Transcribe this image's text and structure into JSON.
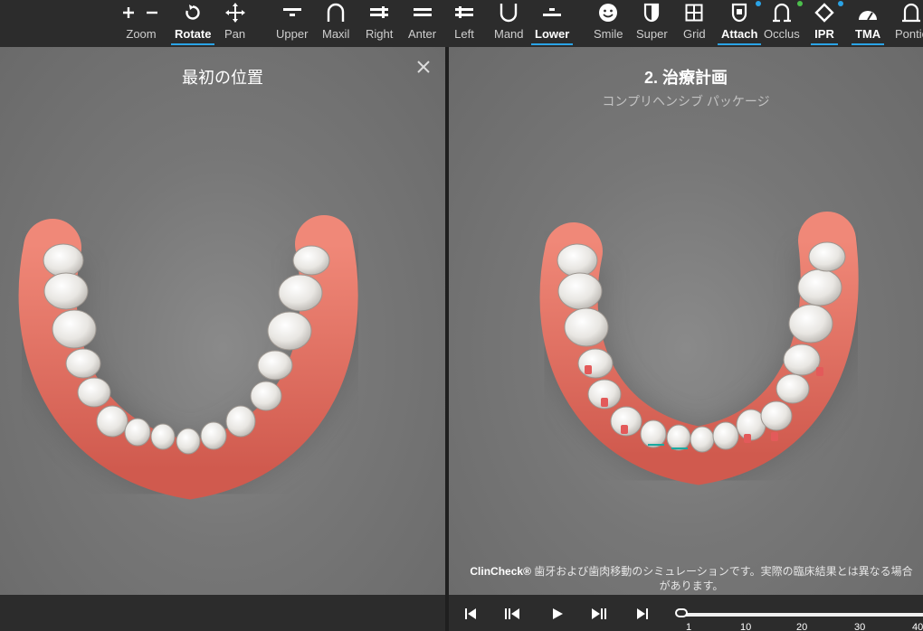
{
  "toolbar": {
    "zoom": {
      "label": "Zoom"
    },
    "rotate": {
      "label": "Rotate"
    },
    "pan": {
      "label": "Pan"
    },
    "upper": {
      "label": "Upper"
    },
    "maxil": {
      "label": "Maxil"
    },
    "right": {
      "label": "Right"
    },
    "anter": {
      "label": "Anter"
    },
    "left": {
      "label": "Left"
    },
    "mand": {
      "label": "Mand"
    },
    "lower": {
      "label": "Lower"
    },
    "smile": {
      "label": "Smile"
    },
    "super": {
      "label": "Super"
    },
    "grid": {
      "label": "Grid"
    },
    "attach": {
      "label": "Attach"
    },
    "occlus": {
      "label": "Occlus"
    },
    "ipr": {
      "label": "IPR"
    },
    "tma": {
      "label": "TMA"
    },
    "pontic": {
      "label": "Pontic"
    },
    "active_items": [
      "Rotate",
      "Lower",
      "Attach",
      "IPR",
      "TMA"
    ]
  },
  "left_panel": {
    "title": "最初の位置"
  },
  "right_panel": {
    "title": "2. 治療計画",
    "subtitle": "コンプリヘンシブ パッケージ",
    "footnote_brand": "ClinCheck®",
    "footnote_text": " 歯牙および歯肉移動のシミュレーションです。実際の臨床結果とは異なる場合があります。"
  },
  "timeline": {
    "ticks": [
      "1",
      "10",
      "20",
      "30",
      "40"
    ],
    "current_stage": "1"
  },
  "colors": {
    "accent": "#2aa3e6",
    "attach_dot": "#2aa3e6",
    "occlus_dot": "#4cbf4c",
    "ipr_dot": "#2aa3e6"
  }
}
